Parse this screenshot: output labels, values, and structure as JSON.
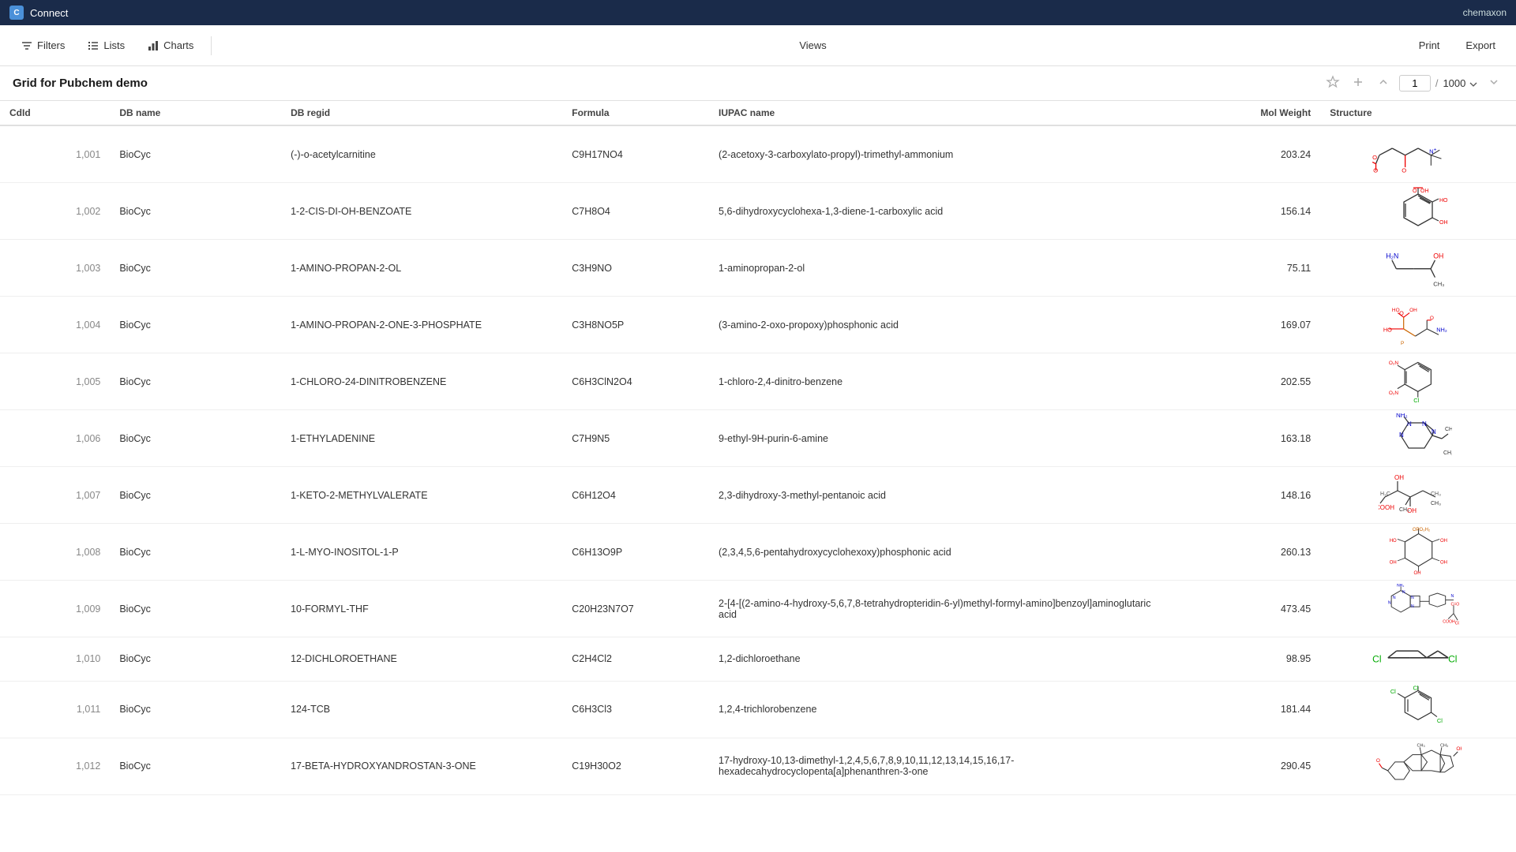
{
  "titleBar": {
    "appName": "Connect",
    "user": "chemaxon"
  },
  "toolbar": {
    "filters": "Filters",
    "lists": "Lists",
    "charts": "Charts",
    "views": "Views",
    "print": "Print",
    "export": "Export"
  },
  "page": {
    "title": "Grid for Pubchem demo",
    "currentPage": "1",
    "totalPages": "1000"
  },
  "table": {
    "columns": [
      "CdId",
      "DB name",
      "DB regid",
      "Formula",
      "IUPAC name",
      "Mol Weight",
      "Structure"
    ],
    "rows": [
      {
        "cdid": "1,001",
        "dbname": "BioCyc",
        "dbregid": "(-)-o-acetylcarnitine",
        "formula": "C9H17NO4",
        "iupac": "(2-acetoxy-3-carboxylato-propyl)-trimethyl-ammonium",
        "molweight": "203.24"
      },
      {
        "cdid": "1,002",
        "dbname": "BioCyc",
        "dbregid": "1-2-CIS-DI-OH-BENZOATE",
        "formula": "C7H8O4",
        "iupac": "5,6-dihydroxycyclohexa-1,3-diene-1-carboxylic acid",
        "molweight": "156.14"
      },
      {
        "cdid": "1,003",
        "dbname": "BioCyc",
        "dbregid": "1-AMINO-PROPAN-2-OL",
        "formula": "C3H9NO",
        "iupac": "1-aminopropan-2-ol",
        "molweight": "75.11"
      },
      {
        "cdid": "1,004",
        "dbname": "BioCyc",
        "dbregid": "1-AMINO-PROPAN-2-ONE-3-PHOSPHATE",
        "formula": "C3H8NO5P",
        "iupac": "(3-amino-2-oxo-propoxy)phosphonic acid",
        "molweight": "169.07"
      },
      {
        "cdid": "1,005",
        "dbname": "BioCyc",
        "dbregid": "1-CHLORO-24-DINITROBENZENE",
        "formula": "C6H3ClN2O4",
        "iupac": "1-chloro-2,4-dinitro-benzene",
        "molweight": "202.55"
      },
      {
        "cdid": "1,006",
        "dbname": "BioCyc",
        "dbregid": "1-ETHYLADENINE",
        "formula": "C7H9N5",
        "iupac": "9-ethyl-9H-purin-6-amine",
        "molweight": "163.18"
      },
      {
        "cdid": "1,007",
        "dbname": "BioCyc",
        "dbregid": "1-KETO-2-METHYLVALERATE",
        "formula": "C6H12O4",
        "iupac": "2,3-dihydroxy-3-methyl-pentanoic acid",
        "molweight": "148.16"
      },
      {
        "cdid": "1,008",
        "dbname": "BioCyc",
        "dbregid": "1-L-MYO-INOSITOL-1-P",
        "formula": "C6H13O9P",
        "iupac": "(2,3,4,5,6-pentahydroxycyclohexoxy)phosphonic acid",
        "molweight": "260.13"
      },
      {
        "cdid": "1,009",
        "dbname": "BioCyc",
        "dbregid": "10-FORMYL-THF",
        "formula": "C20H23N7O7",
        "iupac": "2-[4-[(2-amino-4-hydroxy-5,6,7,8-tetrahydropteridin-6-yl)methyl-formyl-amino]benzoyl]aminoglutaric acid",
        "molweight": "473.45"
      },
      {
        "cdid": "1,010",
        "dbname": "BioCyc",
        "dbregid": "12-DICHLOROETHANE",
        "formula": "C2H4Cl2",
        "iupac": "1,2-dichloroethane",
        "molweight": "98.95"
      },
      {
        "cdid": "1,011",
        "dbname": "BioCyc",
        "dbregid": "124-TCB",
        "formula": "C6H3Cl3",
        "iupac": "1,2,4-trichlorobenzene",
        "molweight": "181.44"
      },
      {
        "cdid": "1,012",
        "dbname": "BioCyc",
        "dbregid": "17-BETA-HYDROXYANDROSTAN-3-ONE",
        "formula": "C19H30O2",
        "iupac": "17-hydroxy-10,13-dimethyl-1,2,4,5,6,7,8,9,10,11,12,13,14,15,16,17-hexadecahydrocyclopenta[a]phenanthren-3-one",
        "molweight": "290.45"
      }
    ]
  }
}
